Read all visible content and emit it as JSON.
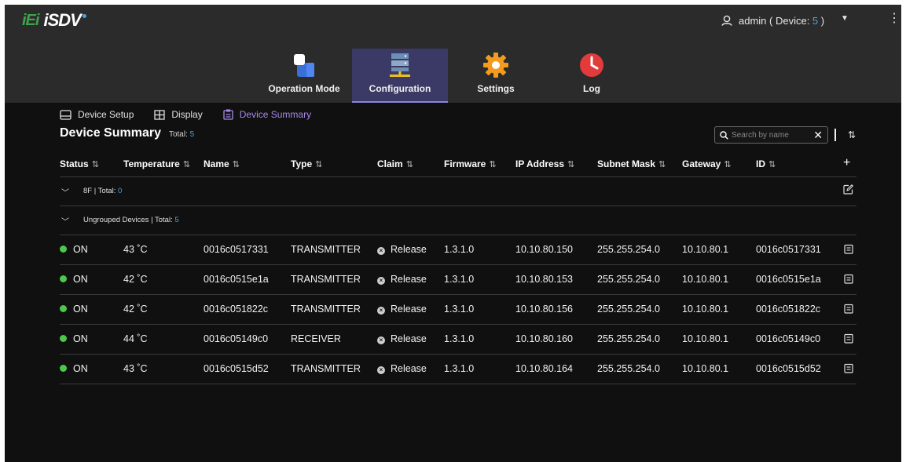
{
  "header": {
    "logo_left": "iEi",
    "logo_right": "iSDV",
    "user_prefix": "admin ( Device: ",
    "device_count": "5",
    "user_suffix": " )"
  },
  "nav": [
    {
      "label": "Operation Mode",
      "icon": "operation-mode-icon",
      "active": false
    },
    {
      "label": "Configuration",
      "icon": "configuration-icon",
      "active": true
    },
    {
      "label": "Settings",
      "icon": "settings-gear-icon",
      "active": false
    },
    {
      "label": "Log",
      "icon": "log-clock-icon",
      "active": false
    }
  ],
  "subtabs": [
    {
      "label": "Device Setup",
      "icon": "device-setup-icon"
    },
    {
      "label": "Display",
      "icon": "display-grid-icon"
    },
    {
      "label": "Device Summary",
      "icon": "device-summary-icon"
    }
  ],
  "summary": {
    "title": "Device Summary",
    "total_label": "Total: ",
    "total": "5"
  },
  "search": {
    "placeholder": "Search by name",
    "value": ""
  },
  "columns": [
    "Status",
    "Temperature",
    "Name",
    "Type",
    "Claim",
    "Firmware",
    "IP Address",
    "Subnet Mask",
    "Gateway",
    "ID"
  ],
  "add_symbol": "+",
  "groups": [
    {
      "label": "8F | Total: ",
      "total": "0"
    },
    {
      "label": "Ungrouped Devices | Total: ",
      "total": "5"
    }
  ],
  "rows": [
    {
      "status": "ON",
      "temp": "43 ˚C",
      "name": "0016c0517331",
      "type": "TRANSMITTER",
      "claim": "Release",
      "firmware": "1.3.1.0",
      "ip": "10.10.80.150",
      "mask": "255.255.254.0",
      "gateway": "10.10.80.1",
      "id": "0016c0517331"
    },
    {
      "status": "ON",
      "temp": "42 ˚C",
      "name": "0016c0515e1a",
      "type": "TRANSMITTER",
      "claim": "Release",
      "firmware": "1.3.1.0",
      "ip": "10.10.80.153",
      "mask": "255.255.254.0",
      "gateway": "10.10.80.1",
      "id": "0016c0515e1a"
    },
    {
      "status": "ON",
      "temp": "42 ˚C",
      "name": "0016c051822c",
      "type": "TRANSMITTER",
      "claim": "Release",
      "firmware": "1.3.1.0",
      "ip": "10.10.80.156",
      "mask": "255.255.254.0",
      "gateway": "10.10.80.1",
      "id": "0016c051822c"
    },
    {
      "status": "ON",
      "temp": "44 ˚C",
      "name": "0016c05149c0",
      "type": "RECEIVER",
      "claim": "Release",
      "firmware": "1.3.1.0",
      "ip": "10.10.80.160",
      "mask": "255.255.254.0",
      "gateway": "10.10.80.1",
      "id": "0016c05149c0"
    },
    {
      "status": "ON",
      "temp": "43 ˚C",
      "name": "0016c0515d52",
      "type": "TRANSMITTER",
      "claim": "Release",
      "firmware": "1.3.1.0",
      "ip": "10.10.80.164",
      "mask": "255.255.254.0",
      "gateway": "10.10.80.1",
      "id": "0016c0515d52"
    }
  ],
  "colors": {
    "accent": "#8c83d9",
    "status_on": "#4cc94c",
    "count_blue": "#4aa3df"
  }
}
